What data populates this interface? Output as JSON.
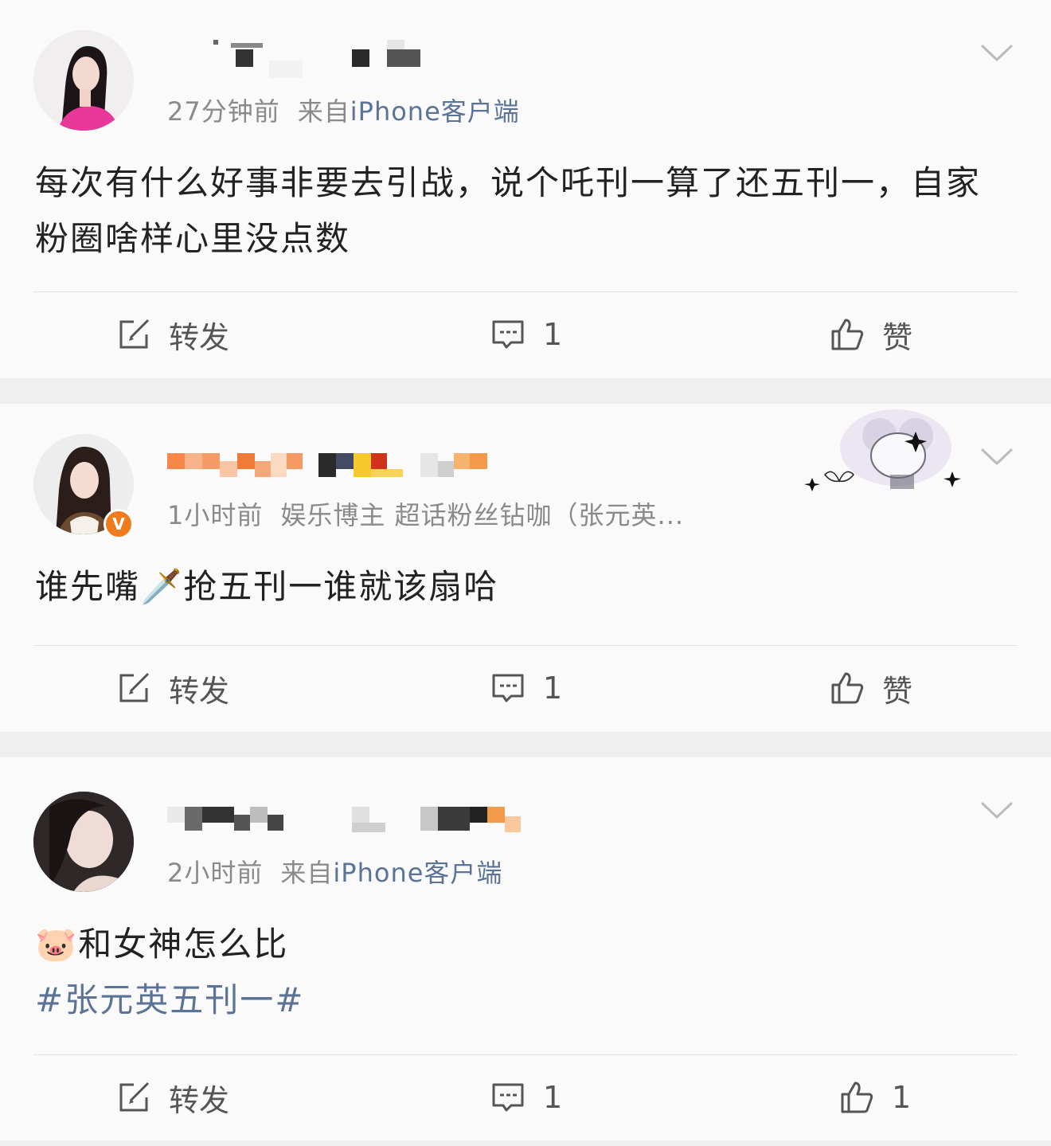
{
  "posts": [
    {
      "meta_time": "27分钟前",
      "meta_source_prefix": "来自",
      "meta_source": "iPhone客户端",
      "content": "每次有什么好事非要去引战，说个吒刊一算了还五刊一，自家粉圈啥样心里没点数",
      "actions": {
        "repost": "转发",
        "comment": "1",
        "like": "赞"
      }
    },
    {
      "meta_time": "1小时前",
      "meta_source_prefix": "",
      "meta_source": "娱乐博主 超话粉丝钻咖（张元英...",
      "verified_badge": "V",
      "content": "谁先嘴🗡️抢五刊一谁就该扇哈",
      "actions": {
        "repost": "转发",
        "comment": "1",
        "like": "赞"
      }
    },
    {
      "meta_time": "2小时前",
      "meta_source_prefix": "来自",
      "meta_source": "iPhone客户端",
      "content": "🐷和女神怎么比",
      "topic": "#张元英五刊一#",
      "actions": {
        "repost": "转发",
        "comment": "1",
        "like": "1"
      }
    }
  ],
  "colors": {
    "link": "#5b7396",
    "meta": "#8a8a8a",
    "text": "#222222",
    "separator_band": "#efefef",
    "card": "#fafafa",
    "verified": "#f07b1c"
  },
  "icons": [
    "repost-icon",
    "comment-icon",
    "like-icon",
    "chevron-down-icon"
  ]
}
